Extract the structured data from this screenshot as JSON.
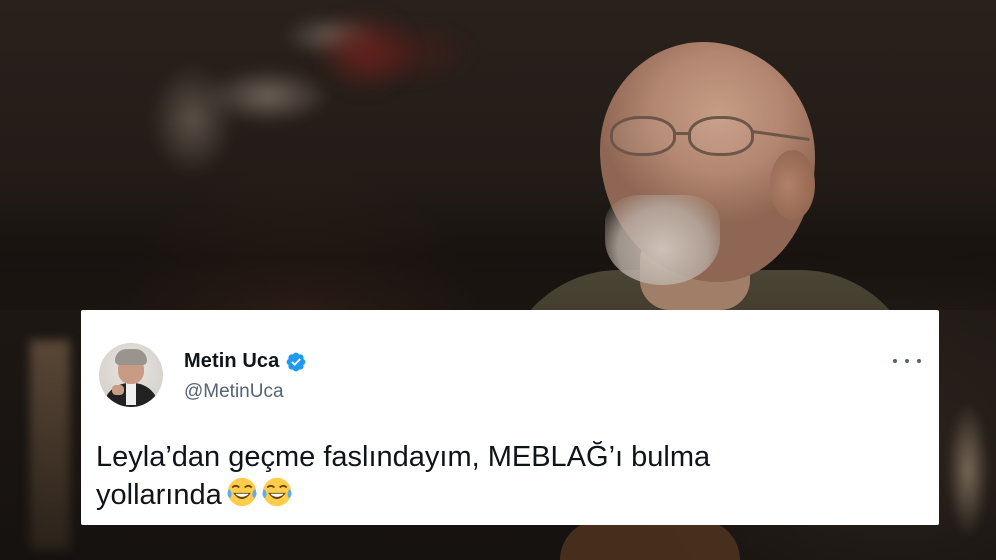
{
  "tweet": {
    "display_name": "Metin Uca",
    "handle": "@MetinUca",
    "verified": true,
    "text_line1": "Leyla’dan geçme faslındayım, MEBLAĞ’ı bulma",
    "text_line2": "yollarında",
    "emojis": [
      "face-with-tears-of-joy",
      "face-with-tears-of-joy"
    ],
    "more_icon": "more-options-icon"
  },
  "colors": {
    "card_background": "#ffffff",
    "name_color": "#0f1419",
    "handle_color": "#536471",
    "verified_blue": "#1d9bf0"
  }
}
